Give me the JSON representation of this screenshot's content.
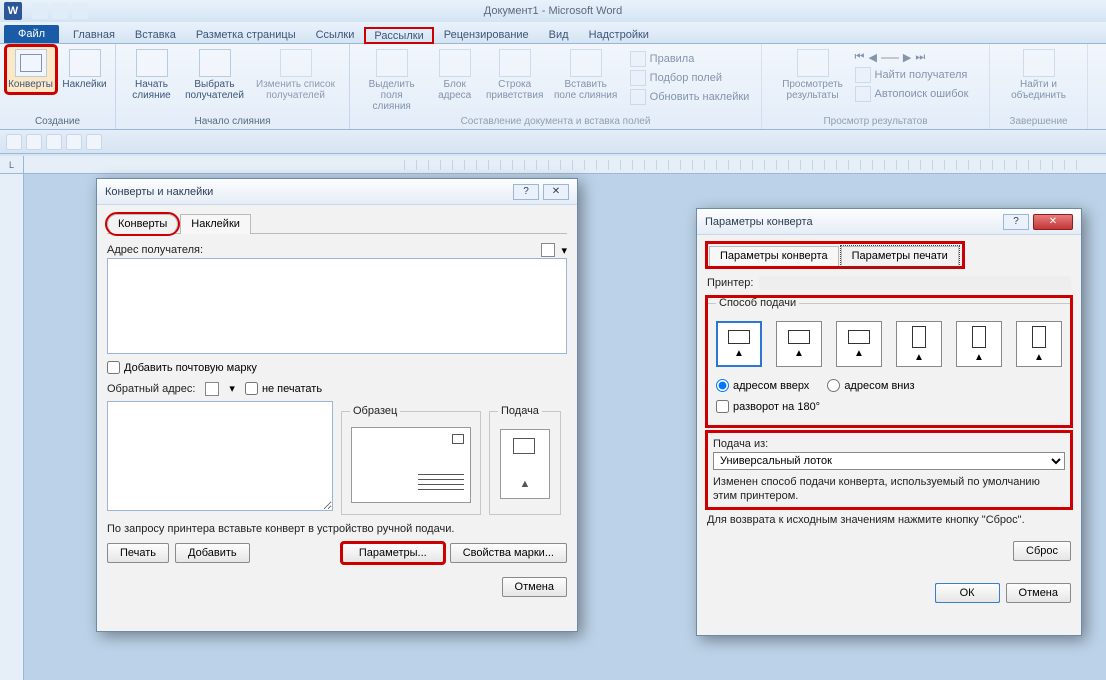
{
  "titlebar": {
    "doc_title": "Документ1 - Microsoft Word"
  },
  "tabs": {
    "file": "Файл",
    "items": [
      "Главная",
      "Вставка",
      "Разметка страницы",
      "Ссылки",
      "Рассылки",
      "Рецензирование",
      "Вид",
      "Надстройки"
    ],
    "highlight_index": 4
  },
  "ribbon": {
    "group_create": {
      "label": "Создание",
      "envelopes": "Конверты",
      "labels": "Наклейки"
    },
    "group_start": {
      "label": "Начало слияния",
      "start": "Начать слияние",
      "select": "Выбрать получателей",
      "edit": "Изменить список получателей"
    },
    "group_compose": {
      "label": "Составление документа и вставка полей",
      "hlfields": "Выделить поля слияния",
      "addrblock": "Блок адреса",
      "greeting": "Строка приветствия",
      "insertfield": "Вставить поле слияния",
      "rules": "Правила",
      "match": "Подбор полей",
      "update": "Обновить наклейки"
    },
    "group_preview": {
      "label": "Просмотр результатов",
      "preview": "Просмотреть результаты",
      "find": "Найти получателя",
      "auto": "Автопоиск ошибок"
    },
    "group_finish": {
      "label": "Завершение",
      "finish": "Найти и объединить"
    }
  },
  "dlg1": {
    "title": "Конверты и наклейки",
    "tab_env": "Конверты",
    "tab_lbl": "Наклейки",
    "recipient": "Адрес получателя:",
    "add_stamp": "Добавить почтовую марку",
    "return_addr": "Обратный адрес:",
    "no_print": "не печатать",
    "sample": "Образец",
    "feed": "Подача",
    "hint": "По запросу принтера вставьте конверт в устройство ручной подачи.",
    "btn_print": "Печать",
    "btn_add": "Добавить",
    "btn_params": "Параметры...",
    "btn_stampprops": "Свойства марки...",
    "btn_cancel": "Отмена"
  },
  "dlg2": {
    "title": "Параметры конверта",
    "tab_env": "Параметры конверта",
    "tab_print": "Параметры  печати",
    "printer_label": "Принтер:",
    "feed_group": "Способ подачи",
    "addr_up": "адресом вверх",
    "addr_down": "адресом вниз",
    "rotate": "разворот на 180°",
    "feed_from": "Подача из:",
    "feed_from_value": "Универсальный лоток",
    "changed_note": "Изменен способ подачи конверта, используемый по умолчанию этим принтером.",
    "reset_note": "Для возврата к исходным значениям нажмите кнопку \"Сброс\".",
    "btn_reset": "Сброс",
    "btn_ok": "ОК",
    "btn_cancel": "Отмена"
  }
}
